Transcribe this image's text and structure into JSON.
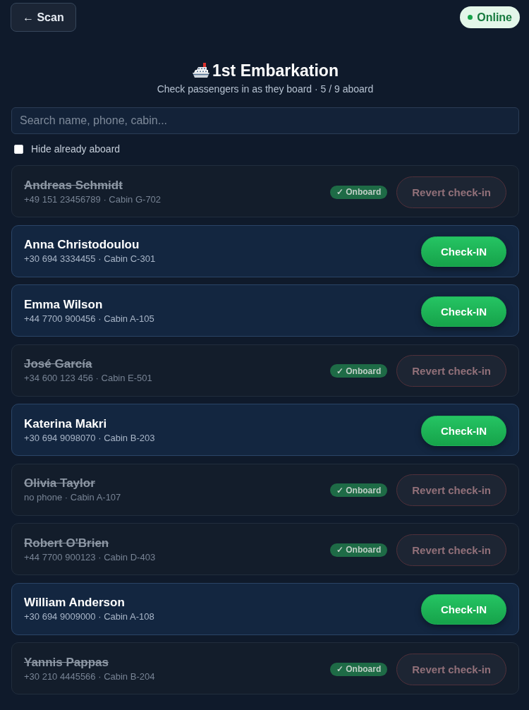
{
  "back_button": {
    "label": "← Scan"
  },
  "status": {
    "label": "Online",
    "online": true
  },
  "header": {
    "title": "1st Embarkation",
    "subtitle": "Check passengers in as they board · 5 / 9 aboard"
  },
  "search": {
    "placeholder": "Search name, phone, cabin..."
  },
  "filter": {
    "label": "Hide already aboard",
    "checked": false
  },
  "passengers": [
    {
      "name": "Andreas Schmidt",
      "details": "+49 151 23456789 · Cabin G-702",
      "onboard": true,
      "badge": "✓ Onboard",
      "action": "Revert check-in"
    },
    {
      "name": "Anna Christodoulou",
      "details": "+30 694 3334455 · Cabin C-301",
      "onboard": false,
      "action": "Check-IN"
    },
    {
      "name": "Emma Wilson",
      "details": "+44 7700 900456 · Cabin A-105",
      "onboard": false,
      "action": "Check-IN"
    },
    {
      "name": "José García",
      "details": "+34 600 123 456 · Cabin E-501",
      "onboard": true,
      "badge": "✓ Onboard",
      "action": "Revert check-in"
    },
    {
      "name": "Katerina Makri",
      "details": "+30 694 9098070 · Cabin B-203",
      "onboard": false,
      "action": "Check-IN"
    },
    {
      "name": "Olivia Taylor",
      "details": "no phone · Cabin A-107",
      "onboard": true,
      "badge": "✓ Onboard",
      "action": "Revert check-in"
    },
    {
      "name": "Robert O'Brien",
      "details": "+44 7700 900123 · Cabin D-403",
      "onboard": true,
      "badge": "✓ Onboard",
      "action": "Revert check-in"
    },
    {
      "name": "William Anderson",
      "details": "+30 694 9009000 · Cabin A-108",
      "onboard": false,
      "action": "Check-IN"
    },
    {
      "name": "Yannis Pappas",
      "details": "+30 210 4445566 · Cabin B-204",
      "onboard": true,
      "badge": "✓ Onboard",
      "action": "Revert check-in"
    }
  ]
}
